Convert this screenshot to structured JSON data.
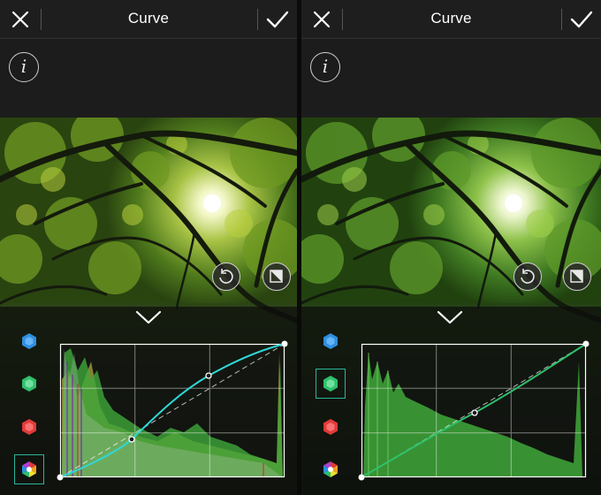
{
  "left_screen": {
    "title": "Curve",
    "close_icon": "close-icon",
    "apply_icon": "checkmark-icon",
    "info_label": "i",
    "reset_icon": "undo-icon",
    "compare_icon": "compare-icon",
    "collapse_icon": "chevron-down-icon",
    "channels": [
      {
        "name": "blue",
        "color": "#2f8fe0",
        "selected": false
      },
      {
        "name": "green",
        "color": "#2fbf6c",
        "selected": false
      },
      {
        "name": "red",
        "color": "#e23a3a",
        "selected": false
      },
      {
        "name": "rgb",
        "color": "multicolor",
        "selected": true
      }
    ],
    "curve_color": "#2fd8d8",
    "histogram_colors": [
      "#ffffff",
      "#3fb33f",
      "#b8b020",
      "#cc2222",
      "#4444dd"
    ]
  },
  "right_screen": {
    "title": "Curve",
    "close_icon": "close-icon",
    "apply_icon": "checkmark-icon",
    "info_label": "i",
    "reset_icon": "undo-icon",
    "compare_icon": "compare-icon",
    "collapse_icon": "chevron-down-icon",
    "channels": [
      {
        "name": "blue",
        "color": "#2f8fe0",
        "selected": false
      },
      {
        "name": "green",
        "color": "#2fbf6c",
        "selected": true
      },
      {
        "name": "red",
        "color": "#e23a3a",
        "selected": false
      },
      {
        "name": "rgb",
        "color": "multicolor",
        "selected": false
      }
    ],
    "curve_color": "#2fbf6c",
    "histogram_colors": [
      "#3fb33f"
    ]
  }
}
